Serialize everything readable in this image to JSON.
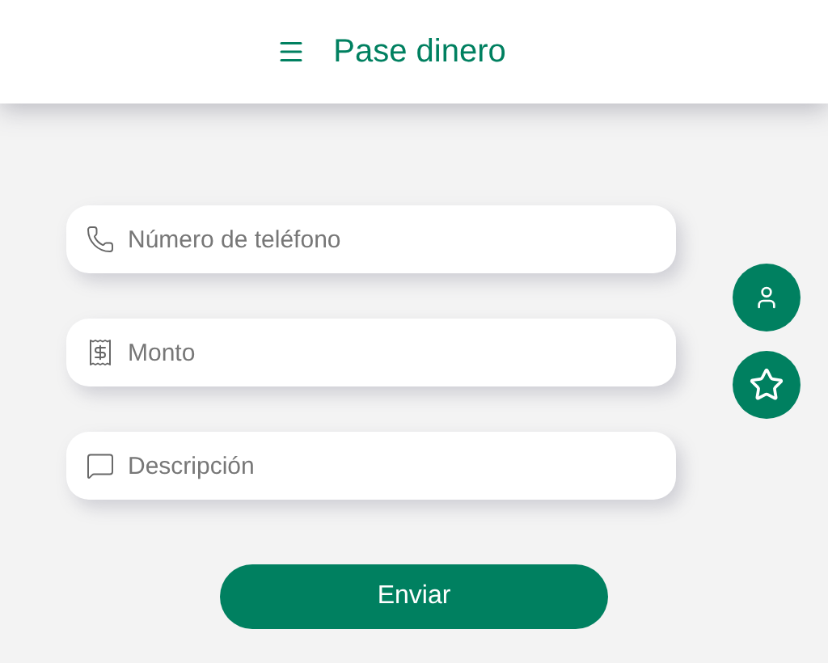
{
  "header": {
    "title": "Pase dinero"
  },
  "fields": [
    {
      "kind": "phone",
      "placeholder": "Número de teléfono"
    },
    {
      "kind": "amount",
      "placeholder": "Monto"
    },
    {
      "kind": "comment",
      "placeholder": "Descripción"
    }
  ],
  "side_buttons": [
    {
      "kind": "contact"
    },
    {
      "kind": "favorite"
    }
  ],
  "submit": {
    "label": "Enviar"
  }
}
